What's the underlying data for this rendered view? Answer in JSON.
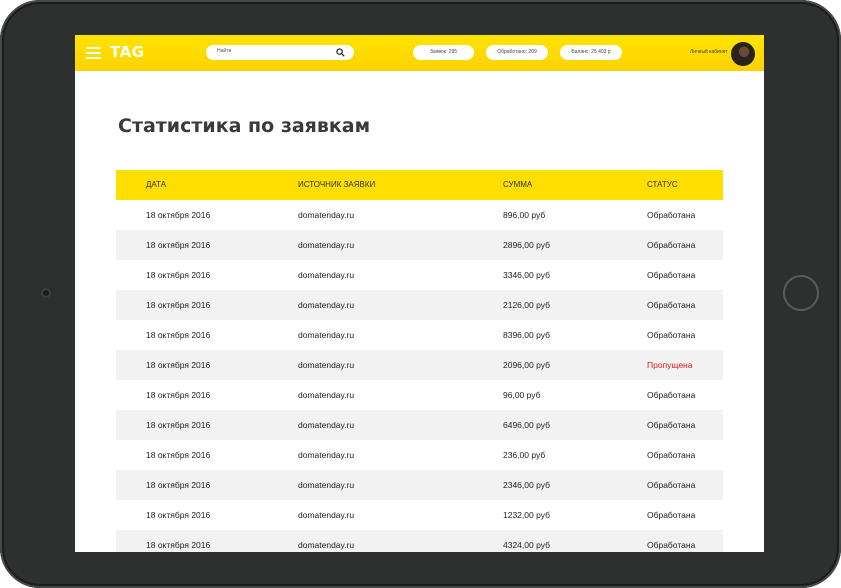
{
  "header": {
    "logo": "TAG",
    "search_placeholder": "Найти",
    "stats": [
      "Заявок: 295",
      "Обработано: 209",
      "Баланс: 25 403 р"
    ],
    "account": "Личный кабинет"
  },
  "page": {
    "title": "Статистика по заявкам"
  },
  "table": {
    "columns": [
      "ДАТА",
      "ИСТОЧНИК ЗАЯВКИ",
      "СУММА",
      "СТАТУС"
    ],
    "rows": [
      [
        "18 октября 2016",
        "domatenday.ru",
        "896,00 руб",
        "Обработана"
      ],
      [
        "18 октября 2016",
        "domatenday.ru",
        "2896,00 руб",
        "Обработана"
      ],
      [
        "18 октября 2016",
        "domatenday.ru",
        "3346,00 руб",
        "Обработана"
      ],
      [
        "18 октября 2016",
        "domatenday.ru",
        "2126,00 руб",
        "Обработана"
      ],
      [
        "18 октября 2016",
        "domatenday.ru",
        "8396,00 руб",
        "Обработана"
      ],
      [
        "18 октября 2016",
        "domatenday.ru",
        "2096,00 руб",
        "Пропущена"
      ],
      [
        "18 октября 2016",
        "domatenday.ru",
        "96,00 руб",
        "Обработана"
      ],
      [
        "18 октября 2016",
        "domatenday.ru",
        "6496,00 руб",
        "Обработана"
      ],
      [
        "18 октября 2016",
        "domatenday.ru",
        "236,00 руб",
        "Обработана"
      ],
      [
        "18 октября 2016",
        "domatenday.ru",
        "2346,00 руб",
        "Обработана"
      ],
      [
        "18 октября 2016",
        "domatenday.ru",
        "1232,00 руб",
        "Обработана"
      ],
      [
        "18 октября 2016",
        "domatenday.ru",
        "4324,00 руб",
        "Обработана"
      ]
    ]
  },
  "colors": {
    "accent": "#ffde00",
    "missed": "#e8171c"
  }
}
